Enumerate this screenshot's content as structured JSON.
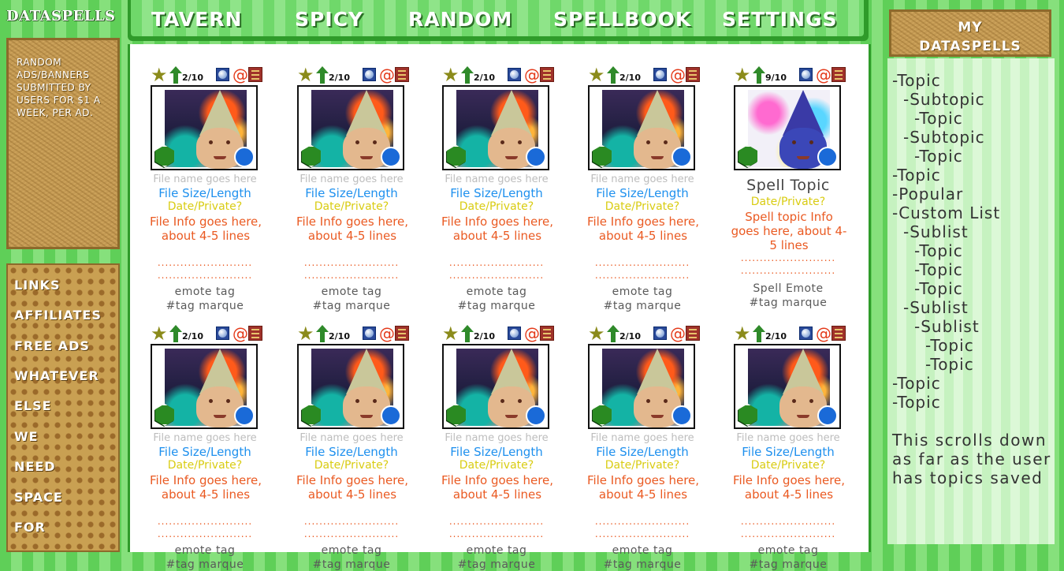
{
  "brand": {
    "logo": "DATASPELLS"
  },
  "ads": {
    "text": "RANDOM ADS/BANNERS SUBMITTED BY USERS FOR $1 A WEEK, PER AD."
  },
  "links": [
    "LINKS",
    "AFFILIATES",
    "FREE ADS",
    "WHATEVER",
    "ELSE",
    "WE",
    "NEED",
    "SPACE",
    "FOR"
  ],
  "nav": [
    "TAVERN",
    "SPICY",
    "RANDOM",
    "SPELLBOOK",
    "SETTINGS"
  ],
  "cards": [
    {
      "rating": "2/10",
      "title": "File name goes here",
      "size": "File Size/Length",
      "date": "Date/Private?",
      "info": "File Info goes here, about 4-5 lines",
      "emote": "emote tag",
      "tag": "#tag marque"
    },
    {
      "rating": "2/10",
      "title": "File name goes here",
      "size": "File Size/Length",
      "date": "Date/Private?",
      "info": "File Info goes here, about 4-5 lines",
      "emote": "emote tag",
      "tag": "#tag marque"
    },
    {
      "rating": "2/10",
      "title": "File name goes here",
      "size": "File Size/Length",
      "date": "Date/Private?",
      "info": "File Info goes here, about 4-5 lines",
      "emote": "emote tag",
      "tag": "#tag marque"
    },
    {
      "rating": "2/10",
      "title": "File name goes here",
      "size": "File Size/Length",
      "date": "Date/Private?",
      "info": "File Info goes here, about 4-5 lines",
      "emote": "emote tag",
      "tag": "#tag marque"
    },
    {
      "rating": "9/10",
      "title": "Spell Topic",
      "date": "Date/Private?",
      "info": "Spell topic Info goes here, about 4-5 lines",
      "emote": "Spell Emote",
      "tag": "#tag marque"
    },
    {
      "rating": "2/10",
      "title": "File name goes here",
      "size": "File Size/Length",
      "date": "Date/Private?",
      "info": "File Info goes here, about 4-5 lines",
      "emote": "emote tag",
      "tag": "#tag marque"
    },
    {
      "rating": "2/10",
      "title": "File name goes here",
      "size": "File Size/Length",
      "date": "Date/Private?",
      "info": "File Info goes here, about 4-5 lines",
      "emote": "emote tag",
      "tag": "#tag marque"
    },
    {
      "rating": "2/10",
      "title": "File name goes here",
      "size": "File Size/Length",
      "date": "Date/Private?",
      "info": "File Info goes here, about 4-5 lines",
      "emote": "emote tag",
      "tag": "#tag marque"
    },
    {
      "rating": "2/10",
      "title": "File name goes here",
      "size": "File Size/Length",
      "date": "Date/Private?",
      "info": "File Info goes here, about 4-5 lines",
      "emote": "emote tag",
      "tag": "#tag marque"
    },
    {
      "rating": "2/10",
      "title": "File name goes here",
      "size": "File Size/Length",
      "date": "Date/Private?",
      "info": "File Info goes here, about 4-5 lines",
      "emote": "emote tag",
      "tag": "#tag marque"
    }
  ],
  "card_dots": ".........................",
  "sidebar": {
    "title_line1": "MY",
    "title_line2": "DATASPELLS",
    "topics": [
      "-Topic",
      "-Subtopic",
      "-Topic",
      "-Subtopic",
      "-Topic",
      "-Topic",
      "-Popular",
      "-Custom List",
      "-Sublist",
      "-Topic",
      "-Topic",
      "-Topic",
      "-Sublist",
      "-Sublist",
      "-Topic",
      "-Topic",
      "-Topic",
      "-Topic"
    ],
    "scroll_note": "This scrolls down as far as the user has topics saved"
  },
  "colors": {
    "green_stripe_dark": "#5fcf58",
    "green_stripe_light": "#86e07c",
    "nav_border": "#2f9b2a",
    "wood": "#c49a54",
    "file_size_blue": "#1e90ee",
    "date_yellow": "#d9cc12",
    "info_orange": "#ea5a22"
  },
  "icons": [
    "star-icon",
    "up-arrow-icon",
    "sphere-icon",
    "swirl-icon",
    "scroll-icon",
    "hexagon-badge-icon",
    "blue-dot-icon"
  ]
}
